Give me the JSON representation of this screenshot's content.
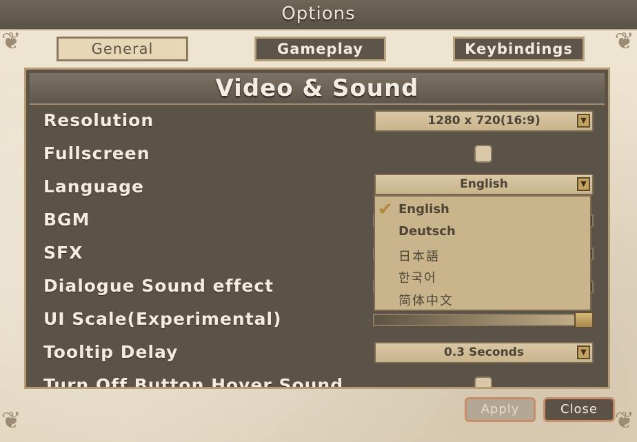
{
  "window": {
    "title": "Options"
  },
  "tabs": [
    {
      "label": "General",
      "active": true
    },
    {
      "label": "Gameplay",
      "active": false
    },
    {
      "label": "Keybindings",
      "active": false
    }
  ],
  "section": {
    "title": "Video & Sound"
  },
  "settings": {
    "resolution": {
      "label": "Resolution",
      "value": "1280 x 720(16:9)"
    },
    "fullscreen": {
      "label": "Fullscreen",
      "checked": false
    },
    "language": {
      "label": "Language",
      "value": "English",
      "options": [
        "English",
        "Deutsch",
        "日本語",
        "한국어",
        "简体中文"
      ],
      "selected_index": 0
    },
    "bgm": {
      "label": "BGM"
    },
    "sfx": {
      "label": "SFX"
    },
    "dialogue": {
      "label": "Dialogue Sound effect"
    },
    "ui_scale": {
      "label": "UI Scale(Experimental)",
      "level": 1.0
    },
    "tooltip_delay": {
      "label": "Tooltip Delay",
      "value": "0.3 Seconds"
    },
    "hover_sound": {
      "label": "Turn Off Button Hover Sound",
      "checked": false
    }
  },
  "footer": {
    "apply_label": "Apply",
    "close_label": "Close"
  },
  "colors": {
    "accent": "#c6a35c",
    "panel": "#5b5348",
    "button_border": "#c68f6a"
  }
}
